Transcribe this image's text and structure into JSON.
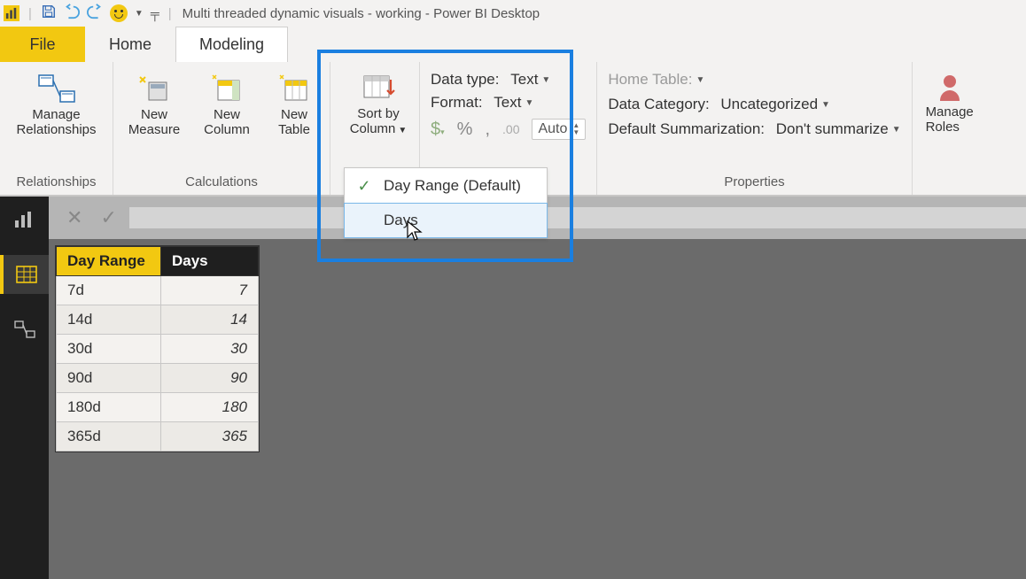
{
  "title": "Multi threaded dynamic visuals - working - Power BI Desktop",
  "tabs": {
    "file": "File",
    "home": "Home",
    "modeling": "Modeling"
  },
  "ribbon": {
    "relationships": {
      "manage": "Manage\nRelationships",
      "group": "Relationships"
    },
    "calculations": {
      "measure": "New\nMeasure",
      "column": "New\nColumn",
      "table": "New\nTable",
      "group": "Calculations"
    },
    "sort": {
      "label": "Sort by\nColumn",
      "menu": {
        "opt1": "Day Range (Default)",
        "opt2": "Days"
      }
    },
    "formatting": {
      "datatype_lbl": "Data type:",
      "datatype_val": "Text",
      "format_lbl": "Format:",
      "format_val": "Text",
      "auto": "Auto"
    },
    "properties": {
      "hometable_lbl": "Home Table:",
      "datacategory_lbl": "Data Category:",
      "datacategory_val": "Uncategorized",
      "summarization_lbl": "Default Summarization:",
      "summarization_val": "Don't summarize",
      "group": "Properties"
    },
    "security": {
      "roles": "Manage\nRoles"
    }
  },
  "table": {
    "headers": {
      "c1": "Day Range",
      "c2": "Days"
    },
    "rows": [
      {
        "range": "7d",
        "days": "7"
      },
      {
        "range": "14d",
        "days": "14"
      },
      {
        "range": "30d",
        "days": "30"
      },
      {
        "range": "90d",
        "days": "90"
      },
      {
        "range": "180d",
        "days": "180"
      },
      {
        "range": "365d",
        "days": "365"
      }
    ]
  }
}
